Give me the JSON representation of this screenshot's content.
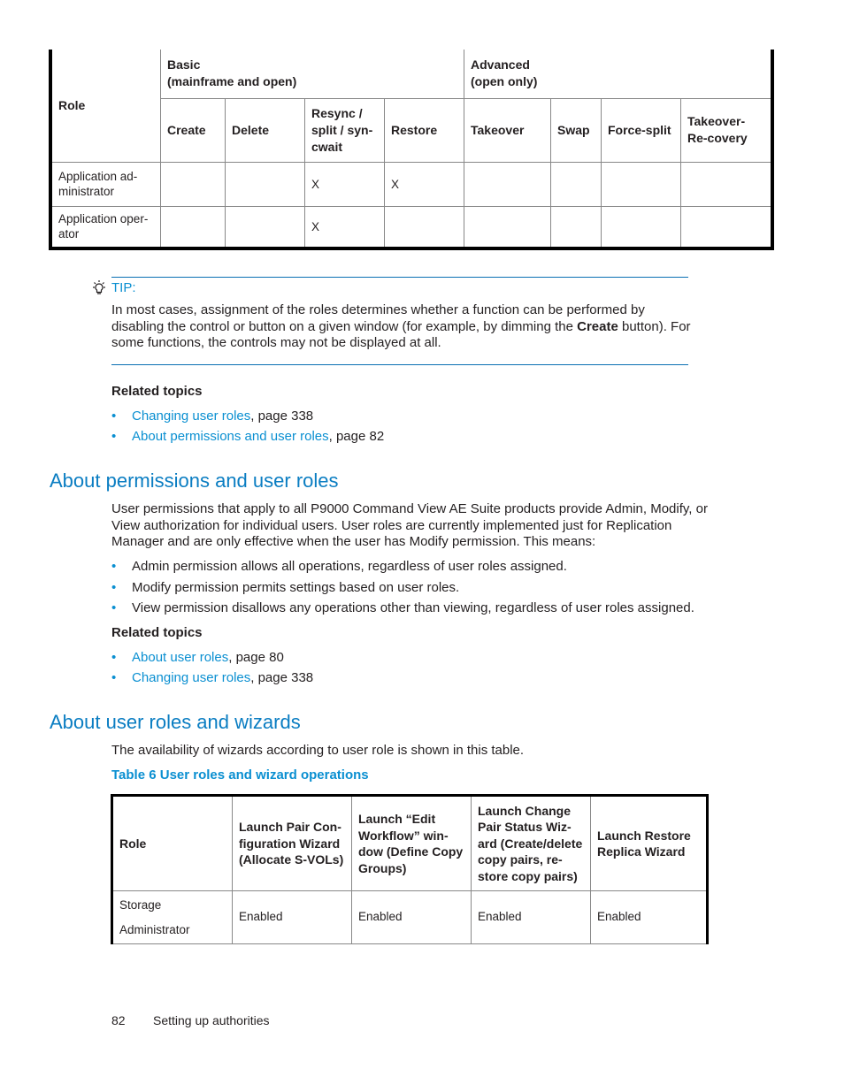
{
  "table1": {
    "role_header": "Role",
    "group_basic": [
      "Basic",
      "(mainframe and open)"
    ],
    "group_advanced": [
      "Advanced",
      "(open only)"
    ],
    "columns": [
      "Create",
      "Delete",
      "Resync / split / syn-cwait",
      "Restore",
      "Takeover",
      "Swap",
      "Force-split",
      "Takeover-Re-covery"
    ],
    "rows": [
      {
        "role": "Application ad-ministrator",
        "cells": [
          "",
          "",
          "X",
          "X",
          "",
          "",
          "",
          ""
        ]
      },
      {
        "role": "Application oper-ator",
        "cells": [
          "",
          "",
          "X",
          "",
          "",
          "",
          "",
          ""
        ]
      }
    ]
  },
  "tip": {
    "label": "TIP:",
    "text_before": "In most cases, assignment of the roles determines whether a function can be performed by disabling the control or button on a given window (for example, by dimming the ",
    "bold": "Create",
    "text_after": " button). For some functions, the controls may not be displayed at all."
  },
  "related1": {
    "heading": "Related topics",
    "items": [
      {
        "link": "Changing user roles",
        "suffix": ", page 338"
      },
      {
        "link": "About permissions and user roles",
        "suffix": ", page 82"
      }
    ]
  },
  "section_permissions": {
    "title": "About permissions and user roles",
    "paragraph": "User permissions that apply to all P9000 Command View AE Suite products provide Admin, Modify, or View authorization for individual users. User roles are currently implemented just for Replication Manager and are only effective when the user has Modify permission. This means:",
    "bullets": [
      "Admin permission allows all operations, regardless of user roles assigned.",
      "Modify permission permits settings based on user roles.",
      "View permission disallows any operations other than viewing, regardless of user roles assigned."
    ],
    "related_heading": "Related topics",
    "related": [
      {
        "link": "About user roles",
        "suffix": ", page 80"
      },
      {
        "link": "Changing user roles",
        "suffix": ", page 338"
      }
    ]
  },
  "section_wizards": {
    "title": "About user roles and wizards",
    "paragraph": "The availability of wizards according to user role is shown in this table.",
    "table_caption": "Table 6 User roles and wizard operations"
  },
  "table2": {
    "headers": [
      "Role",
      "Launch Pair Con-figuration Wizard (Allocate S-VOLs)",
      "Launch “Edit Workflow” win-dow (Define Copy Groups)",
      "Launch Change Pair Status Wiz-ard (Create/delete copy pairs, re-store copy pairs)",
      "Launch Restore Replica Wizard"
    ],
    "rows": [
      {
        "role": "Storage Administrator",
        "cells": [
          "Enabled",
          "Enabled",
          "Enabled",
          "Enabled"
        ]
      }
    ]
  },
  "footer": {
    "page_number": "82",
    "section": "Setting up authorities"
  },
  "colors": {
    "link": "#0a8fd1",
    "heading": "#0a7dc2",
    "tip_rule": "#0a6fb3"
  }
}
